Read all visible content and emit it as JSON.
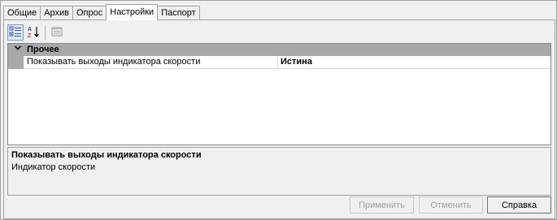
{
  "tabs": [
    {
      "label": "Общие"
    },
    {
      "label": "Архив"
    },
    {
      "label": "Опрос"
    },
    {
      "label": "Настройки",
      "active": true
    },
    {
      "label": "Паспорт"
    }
  ],
  "toolbar": {
    "categorized_icon": "categorized-view-icon",
    "alphabetical_icon": "alphabetical-sort-icon",
    "property_pages_icon": "property-pages-icon"
  },
  "grid": {
    "category": {
      "label": "Прочее",
      "icon": "chevron-down-icon"
    },
    "properties": [
      {
        "name": "Показывать выходы индикатора скорости",
        "value": "Истина"
      }
    ]
  },
  "description": {
    "title": "Показывать выходы индикатора скорости",
    "text": "Индикатор скорости"
  },
  "buttons": {
    "apply": "Применить",
    "cancel": "Отменить",
    "help": "Справка"
  },
  "colors": {
    "category_bg": "#a8a8a8",
    "window_bg": "#f0f0f0",
    "grid_bg": "#ffffff",
    "disabled_text": "#a0a0a0"
  }
}
